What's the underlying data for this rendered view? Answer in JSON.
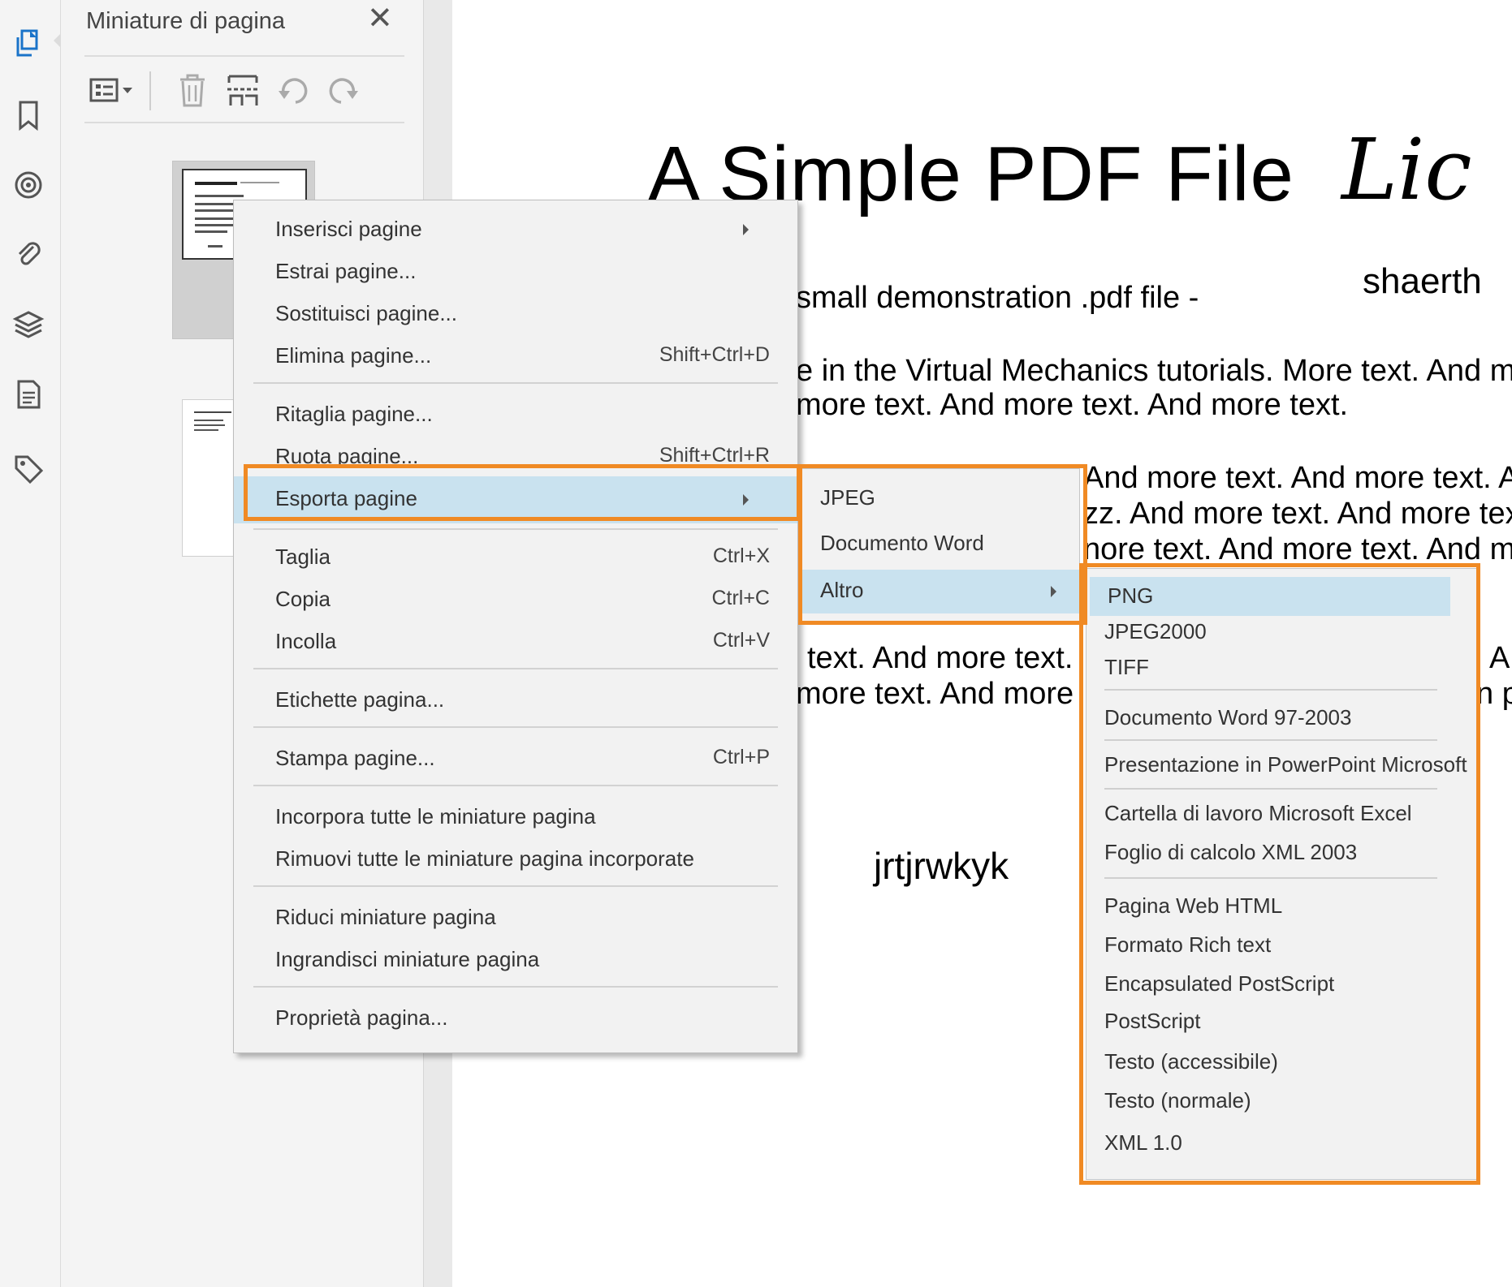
{
  "panel": {
    "title": "Miniature di pagina",
    "close_glyph": "✕",
    "toolbar_icons": [
      "thumbnail-options-icon",
      "delete-pages-icon",
      "insert-pages-icon",
      "rotate-left-icon",
      "rotate-right-icon"
    ]
  },
  "rail_icons": [
    "page-thumbnails-icon",
    "bookmark-icon",
    "target-icon",
    "attachment-icon",
    "layers-icon",
    "page-document-icon",
    "tag-icon"
  ],
  "document": {
    "title": "A Simple PDF File",
    "signature": "Lic",
    "author": "shaerth",
    "line1": "small demonstration .pdf file -",
    "line2": "e in the Virtual Mechanics tutorials. More text. And mo",
    "line3": "more text. And more text. And more text.",
    "line4": "And more text. And more text. A",
    "line5": "zz. And more text. And more tex",
    "line6": "nore text. And more text. And m",
    "line7": "text. And more text.",
    "line8": "more text. And more",
    "line9a": "A",
    "line9b": "n p",
    "bottom": "jrtjrwkyk"
  },
  "context_menu": {
    "items": [
      {
        "label": "Inserisci pagine",
        "shortcut": "",
        "submenu": true
      },
      {
        "label": "Estrai pagine...",
        "shortcut": ""
      },
      {
        "label": "Sostituisci pagine...",
        "shortcut": ""
      },
      {
        "label": "Elimina pagine...",
        "shortcut": "Shift+Ctrl+D"
      },
      {
        "label": "Ritaglia pagine...",
        "shortcut": ""
      },
      {
        "label": "Ruota pagine...",
        "shortcut": "Shift+Ctrl+R"
      },
      {
        "label": "Esporta pagine",
        "shortcut": "",
        "submenu": true,
        "highlighted": true
      },
      {
        "label": "Taglia",
        "shortcut": "Ctrl+X"
      },
      {
        "label": "Copia",
        "shortcut": "Ctrl+C"
      },
      {
        "label": "Incolla",
        "shortcut": "Ctrl+V"
      },
      {
        "label": "Etichette pagina...",
        "shortcut": ""
      },
      {
        "label": "Stampa pagine...",
        "shortcut": "Ctrl+P"
      },
      {
        "label": "Incorpora tutte le miniature pagina",
        "shortcut": ""
      },
      {
        "label": "Rimuovi tutte le miniature pagina incorporate",
        "shortcut": ""
      },
      {
        "label": "Riduci miniature pagina",
        "shortcut": ""
      },
      {
        "label": "Ingrandisci miniature pagina",
        "shortcut": ""
      },
      {
        "label": "Proprietà pagina...",
        "shortcut": ""
      }
    ]
  },
  "export_submenu": {
    "items": [
      {
        "label": "JPEG"
      },
      {
        "label": "Documento Word"
      },
      {
        "label": "Altro",
        "submenu": true,
        "highlighted": true
      }
    ]
  },
  "other_submenu": {
    "items": [
      {
        "label": "PNG",
        "highlighted": true
      },
      {
        "label": "JPEG2000"
      },
      {
        "label": "TIFF"
      },
      {
        "label": "Documento Word 97-2003"
      },
      {
        "label": "Presentazione in PowerPoint Microsoft"
      },
      {
        "label": "Cartella di lavoro Microsoft Excel"
      },
      {
        "label": "Foglio di calcolo XML 2003"
      },
      {
        "label": "Pagina Web HTML"
      },
      {
        "label": "Formato Rich text"
      },
      {
        "label": "Encapsulated PostScript"
      },
      {
        "label": "PostScript"
      },
      {
        "label": "Testo (accessibile)"
      },
      {
        "label": "Testo (normale)"
      },
      {
        "label": "XML 1.0"
      }
    ]
  },
  "colors": {
    "highlight": "#c9e2ef",
    "outline": "#f08a24",
    "accent_icon": "#1a73c9"
  }
}
